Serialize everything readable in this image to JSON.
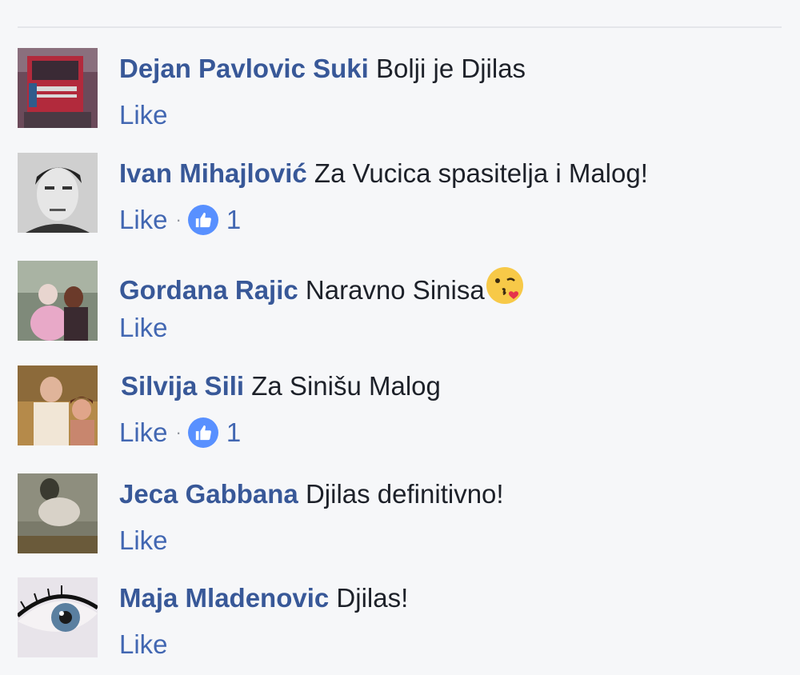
{
  "comments": [
    {
      "author": "Dejan Pavlovic Suki",
      "text": "Bolji je Djilas",
      "like_label": "Like",
      "reaction_count": null,
      "avatar_icon": "truck-photo"
    },
    {
      "author": "Ivan Mihajlović",
      "text": "Za Vucica spasitelja i Malog!",
      "like_label": "Like",
      "reaction_count": "1",
      "avatar_icon": "man-portrait-photo"
    },
    {
      "author": "Gordana Rajic",
      "text": "Naravno Sinisa",
      "like_label": "Like",
      "reaction_count": null,
      "emoji": "kiss-face-emoji",
      "avatar_icon": "woman-with-child-photo"
    },
    {
      "author": "Silvija Sili",
      "text": "Za Sinišu Malog",
      "like_label": "Like",
      "reaction_count": "1",
      "avatar_icon": "couple-photo"
    },
    {
      "author": "Jeca Gabbana",
      "text": "Djilas definitivno!",
      "like_label": "Like",
      "reaction_count": null,
      "avatar_icon": "woman-photo"
    },
    {
      "author": "Maja Mladenovic",
      "text": "Djilas!",
      "like_label": "Like",
      "reaction_count": null,
      "avatar_icon": "eye-closeup-photo"
    }
  ],
  "colors": {
    "background": "#f6f7f9",
    "author": "#385898",
    "link": "#4267b2",
    "like_badge": "#5890ff"
  }
}
